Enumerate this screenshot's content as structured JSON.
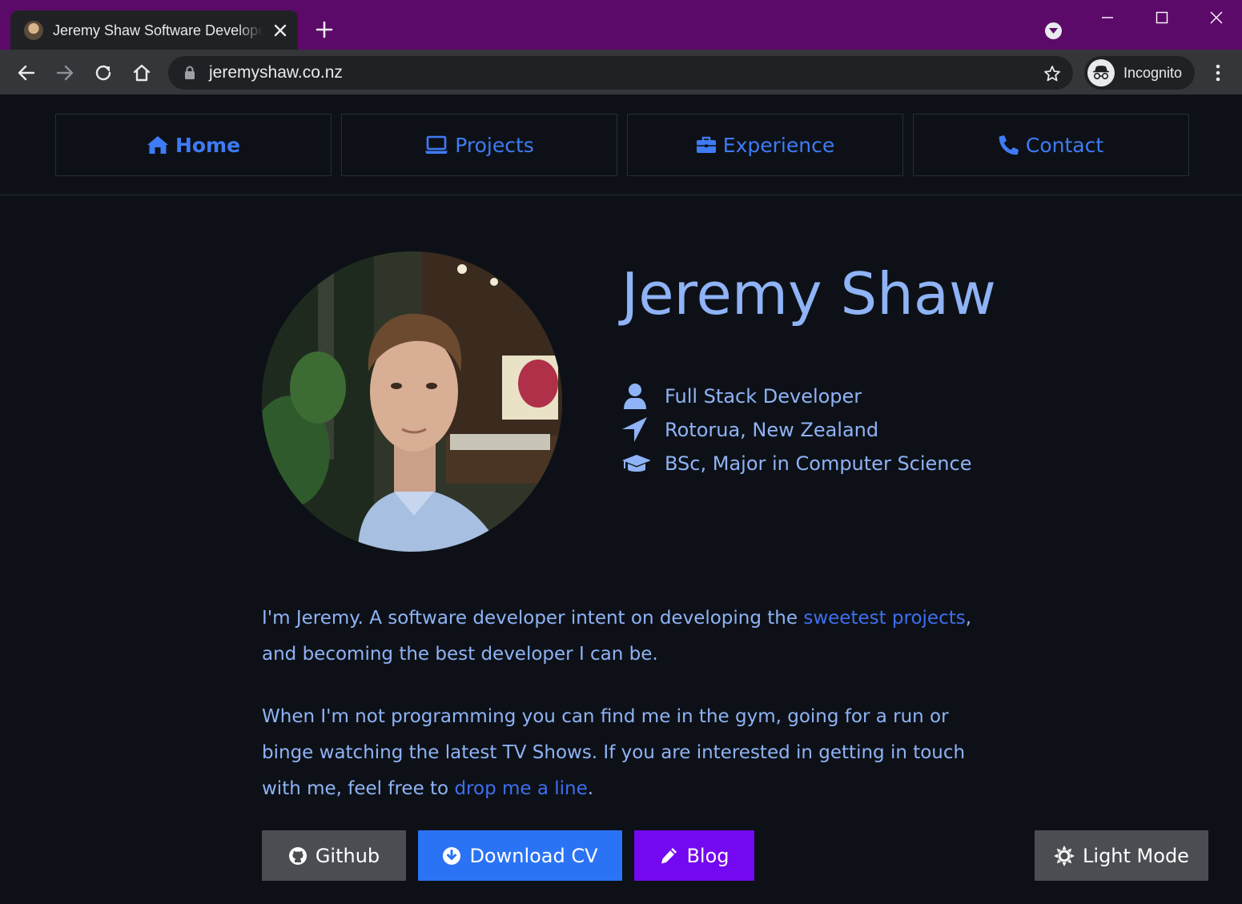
{
  "browser": {
    "tab_title": "Jeremy Shaw Software Developer",
    "url": "jeremyshaw.co.nz",
    "incognito_label": "Incognito",
    "icons": [
      "back-arrow-icon",
      "forward-arrow-icon",
      "reload-icon",
      "home-icon",
      "lock-icon",
      "star-icon",
      "incognito-icon",
      "more-vert-icon",
      "close-icon",
      "plus-icon",
      "tab-search-icon"
    ]
  },
  "nav": {
    "items": [
      {
        "label": "Home",
        "icon": "home-icon",
        "active": true
      },
      {
        "label": "Projects",
        "icon": "laptop-icon",
        "active": false
      },
      {
        "label": "Experience",
        "icon": "briefcase-icon",
        "active": false
      },
      {
        "label": "Contact",
        "icon": "phone-icon",
        "active": false
      }
    ]
  },
  "profile": {
    "name": "Jeremy Shaw",
    "facts": [
      {
        "icon": "user-icon",
        "text": "Full Stack Developer"
      },
      {
        "icon": "location-arrow-icon",
        "text": "Rotorua, New Zealand"
      },
      {
        "icon": "graduation-cap-icon",
        "text": "BSc, Major in Computer Science"
      }
    ]
  },
  "bio": {
    "p1_before": "I'm Jeremy. A software developer intent on developing the ",
    "p1_link": "sweetest projects",
    "p1_after": ", and becoming the best developer I can be.",
    "p2_before": "When I'm not programming you can find me in the gym, going for a run or binge watching the latest TV Shows. If you are interested in getting in touch with me, feel free to ",
    "p2_link": "drop me a line",
    "p2_after": "."
  },
  "buttons": {
    "github": "Github",
    "download_cv": "Download CV",
    "blog": "Blog",
    "light_mode": "Light Mode"
  },
  "colors": {
    "page_background": "#0d1117",
    "accent_text": "#8fb3f6",
    "link": "#3e6ff0",
    "nav_link": "#3e7bf5",
    "download_button": "#2a73f5",
    "blog_button": "#7408f0",
    "neutral_button": "#4a4d52",
    "titlebar": "#5c0a69"
  }
}
